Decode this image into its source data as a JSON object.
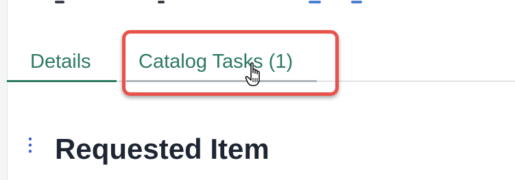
{
  "tabs": [
    {
      "label": "Details",
      "active": true
    },
    {
      "label": "Catalog Tasks (1)",
      "active": false,
      "highlighted": true
    }
  ],
  "section": {
    "title": "Requested Item"
  },
  "colors": {
    "tab_text": "#2b7a5e",
    "highlight_border": "#e8524a",
    "title_text": "#1f2633"
  },
  "icons": {
    "cursor": "hand-pointer-icon",
    "section_menu": "vertical-ellipsis-icon"
  }
}
